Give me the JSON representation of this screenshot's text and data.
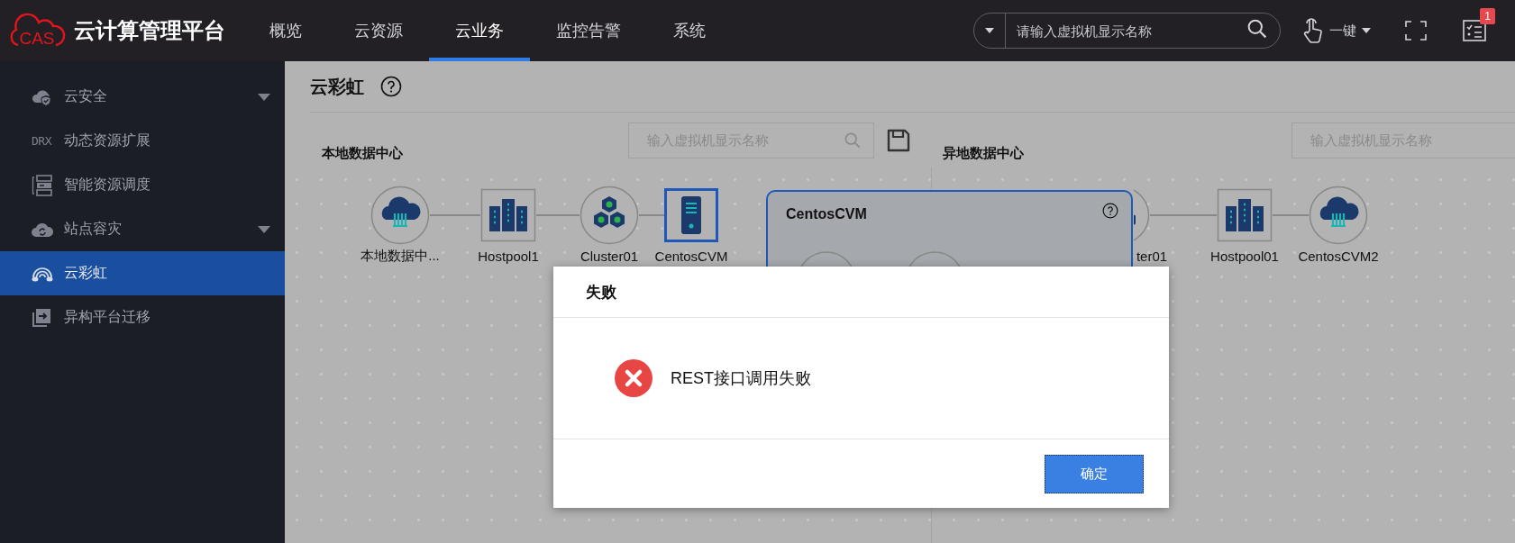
{
  "header": {
    "logo_text": "CAS",
    "app_title": "云计算管理平台",
    "nav": [
      {
        "label": "概览",
        "selected": false
      },
      {
        "label": "云资源",
        "selected": false
      },
      {
        "label": "云业务",
        "selected": true
      },
      {
        "label": "监控告警",
        "selected": false
      },
      {
        "label": "系统",
        "selected": false
      }
    ],
    "search": {
      "placeholder": "请输入虚拟机显示名称"
    },
    "one_click": {
      "label": "一键"
    },
    "task_badge": "1"
  },
  "sidebar": {
    "items": [
      {
        "label": "云安全",
        "collapsible": true,
        "selected": false
      },
      {
        "label": "动态资源扩展",
        "icon_text": "DRX",
        "collapsible": false,
        "selected": false
      },
      {
        "label": "智能资源调度",
        "collapsible": false,
        "selected": false
      },
      {
        "label": "站点容灾",
        "collapsible": true,
        "selected": false
      },
      {
        "label": "云彩虹",
        "collapsible": false,
        "selected": true
      },
      {
        "label": "异构平台迁移",
        "collapsible": false,
        "selected": false
      }
    ]
  },
  "page": {
    "title": "云彩虹",
    "local": {
      "heading": "本地数据中心",
      "search": {
        "placeholder": "输入虚拟机显示名称"
      },
      "nodes": [
        {
          "kind": "datacenter",
          "label": "本地数据中...",
          "selected": false
        },
        {
          "kind": "hostpool",
          "label": "Hostpool1",
          "selected": false
        },
        {
          "kind": "cluster",
          "label": "Cluster01",
          "selected": false
        },
        {
          "kind": "vm",
          "label": "CentosCVM",
          "selected": true
        }
      ]
    },
    "vm_panel": {
      "title": "CentosCVM"
    },
    "remote": {
      "heading": "异地数据中心",
      "search": {
        "placeholder": "输入虚拟机显示名称"
      },
      "nodes": [
        {
          "kind": "cluster",
          "label": "ter01",
          "selected": false
        },
        {
          "kind": "hostpool",
          "label": "Hostpool01",
          "selected": false
        },
        {
          "kind": "datacenter",
          "label": "CentosCVM2",
          "selected": false
        }
      ]
    }
  },
  "dialog": {
    "title": "失败",
    "message": "REST接口调用失败",
    "buttons": [
      "确定"
    ]
  }
}
